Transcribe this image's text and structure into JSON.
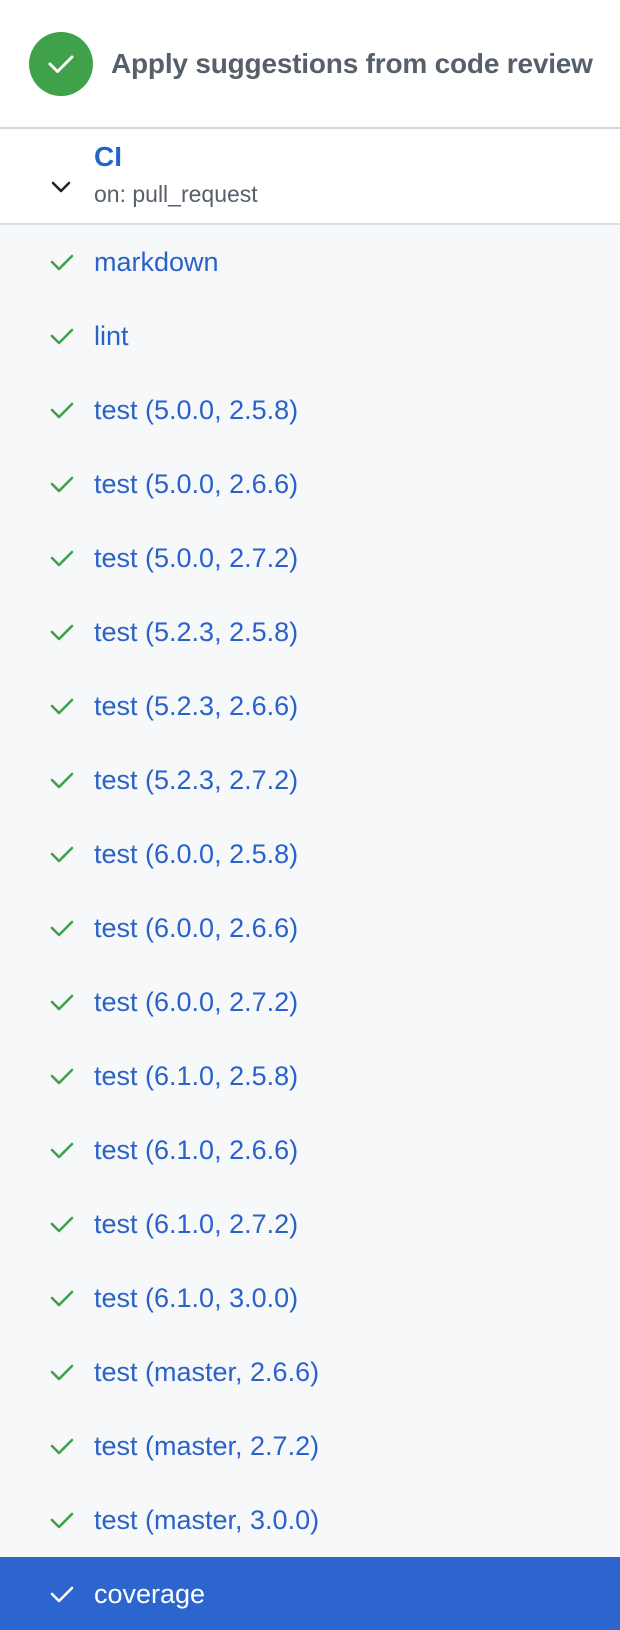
{
  "commit": {
    "title": "Apply suggestions from code review",
    "status_icon": "check-circle-icon",
    "status_color": "#3fa14a"
  },
  "workflow": {
    "name": "CI",
    "trigger": "on: pull_request",
    "expand_icon": "chevron-down-icon"
  },
  "jobs": [
    {
      "label": "markdown"
    },
    {
      "label": "lint"
    },
    {
      "label": "test (5.0.0, 2.5.8)"
    },
    {
      "label": "test (5.0.0, 2.6.6)"
    },
    {
      "label": "test (5.0.0, 2.7.2)"
    },
    {
      "label": "test (5.2.3, 2.5.8)"
    },
    {
      "label": "test (5.2.3, 2.6.6)"
    },
    {
      "label": "test (5.2.3, 2.7.2)"
    },
    {
      "label": "test (6.0.0, 2.5.8)"
    },
    {
      "label": "test (6.0.0, 2.6.6)"
    },
    {
      "label": "test (6.0.0, 2.7.2)"
    },
    {
      "label": "test (6.1.0, 2.5.8)"
    },
    {
      "label": "test (6.1.0, 2.6.6)"
    },
    {
      "label": "test (6.1.0, 2.7.2)"
    },
    {
      "label": "test (6.1.0, 3.0.0)"
    },
    {
      "label": "test (master, 2.6.6)"
    },
    {
      "label": "test (master, 2.7.2)"
    },
    {
      "label": "test (master, 3.0.0)"
    },
    {
      "label": "coverage",
      "selected": true
    }
  ],
  "colors": {
    "success": "#3fa14a",
    "link": "#2a62c9",
    "selected_bg": "#2b65cd",
    "jobs_bg": "#f6f8fa"
  }
}
